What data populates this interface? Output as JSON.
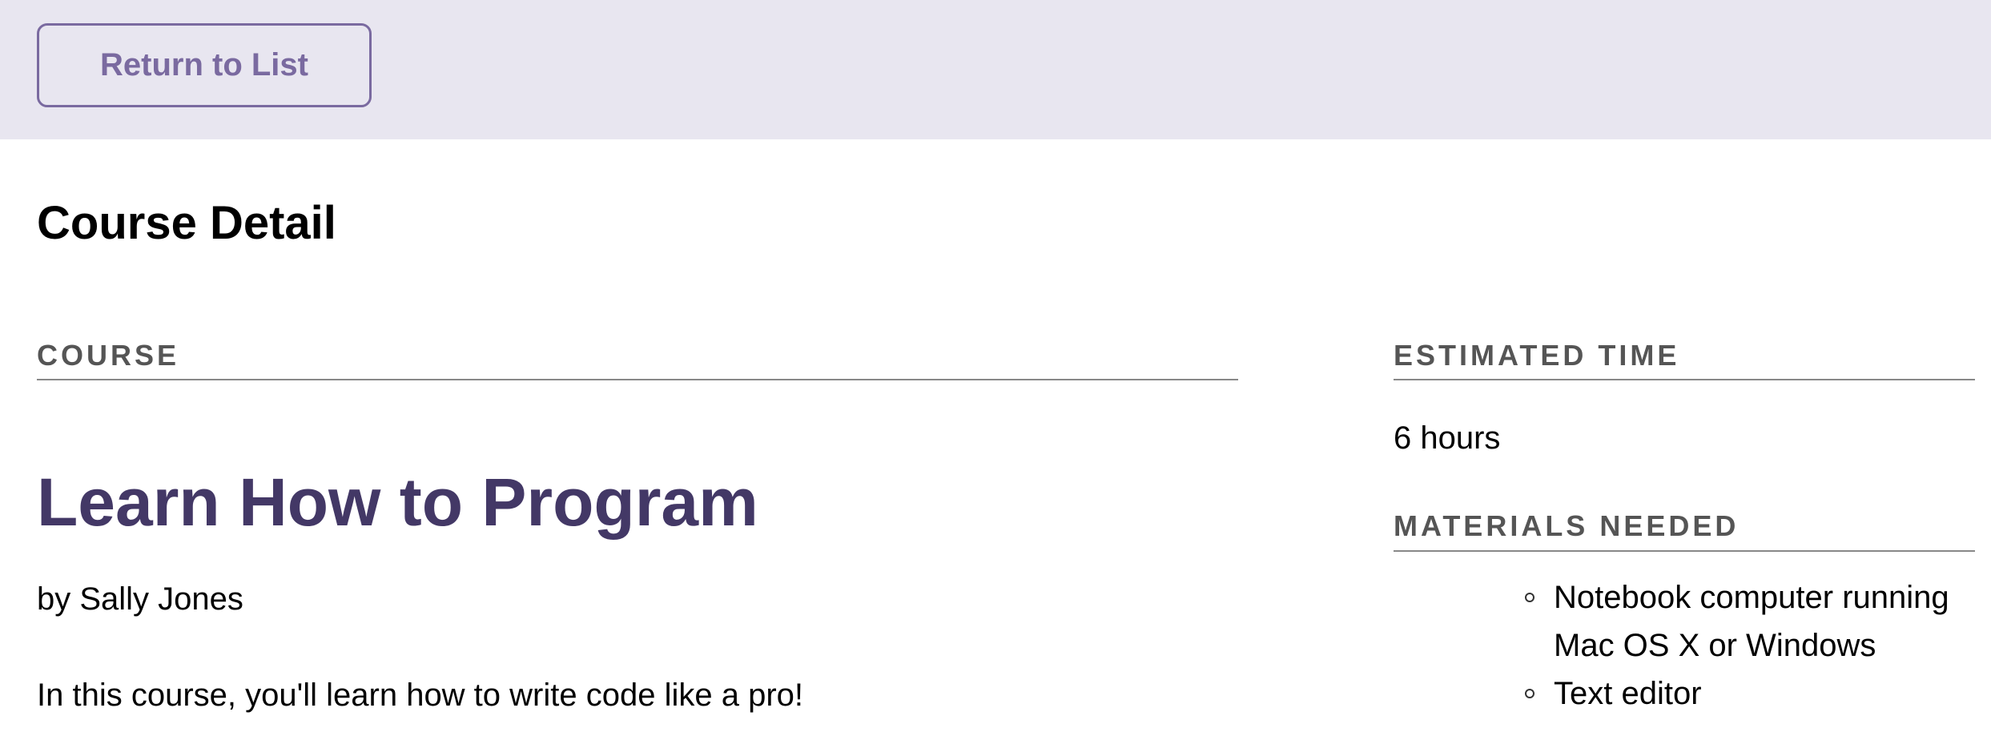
{
  "header": {
    "return_label": "Return to List"
  },
  "page": {
    "title": "Course Detail"
  },
  "course": {
    "section_label": "COURSE",
    "title": "Learn How to Program",
    "author": "by Sally Jones",
    "description": "In this course, you'll learn how to write code like a pro!"
  },
  "sidebar": {
    "time_label": "ESTIMATED TIME",
    "time_value": "6 hours",
    "materials_label": "MATERIALS NEEDED",
    "materials": [
      "Notebook computer running Mac OS X or Windows",
      "Text editor"
    ]
  },
  "colors": {
    "header_bg": "#e8e6f0",
    "accent": "#7a6aa0",
    "course_title": "#433866",
    "label": "#555555"
  }
}
